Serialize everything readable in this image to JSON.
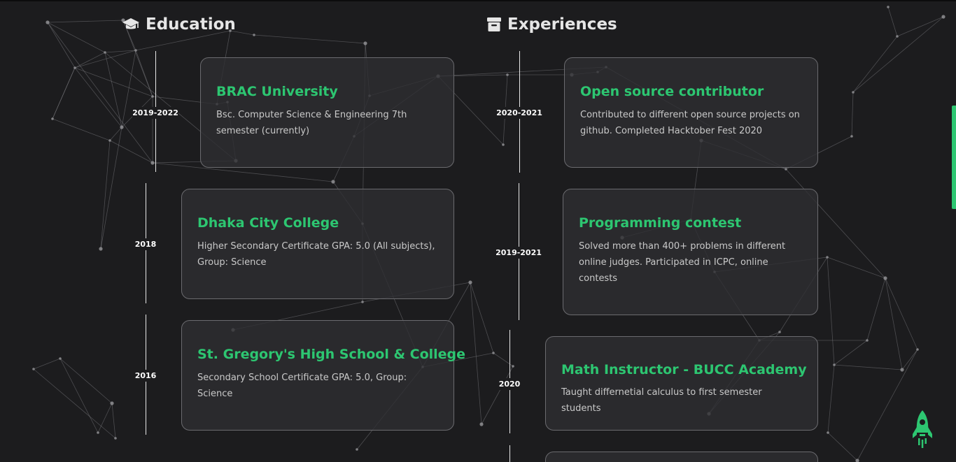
{
  "education": {
    "title": "Education",
    "items": [
      {
        "year": "2019-2022",
        "name": "BRAC University",
        "desc": "Bsc. Computer Science & Engineering 7th semester (currently)"
      },
      {
        "year": "2018",
        "name": "Dhaka City College",
        "desc": "Higher Secondary Certificate GPA: 5.0 (All subjects), Group: Science"
      },
      {
        "year": "2016",
        "name": "St. Gregory's High School & College",
        "desc": "Secondary School Certificate GPA: 5.0, Group: Science"
      }
    ]
  },
  "experiences": {
    "title": "Experiences",
    "items": [
      {
        "year": "2020-2021",
        "name": "Open source contributor",
        "desc": "Contributed to different open source projects on github. Completed Hacktober Fest 2020"
      },
      {
        "year": "2019-2021",
        "name": "Programming contest",
        "desc": "Solved more than 400+ problems in different online judges. Participated in ICPC, online contests"
      },
      {
        "year": "2020",
        "name": "Math Instructor - BUCC Academy",
        "desc": "Taught differnetial calculus to first semester students"
      }
    ]
  },
  "icons": {
    "education": "graduation-cap-icon",
    "experiences": "archive-box-icon",
    "back_to_top": "rocket-icon"
  },
  "colors": {
    "background": "#1c1c1e",
    "accent": "#2dc671",
    "card_background": "#2e2e32",
    "card_border": "#6b6b6f",
    "text": "#c9c9c9"
  }
}
